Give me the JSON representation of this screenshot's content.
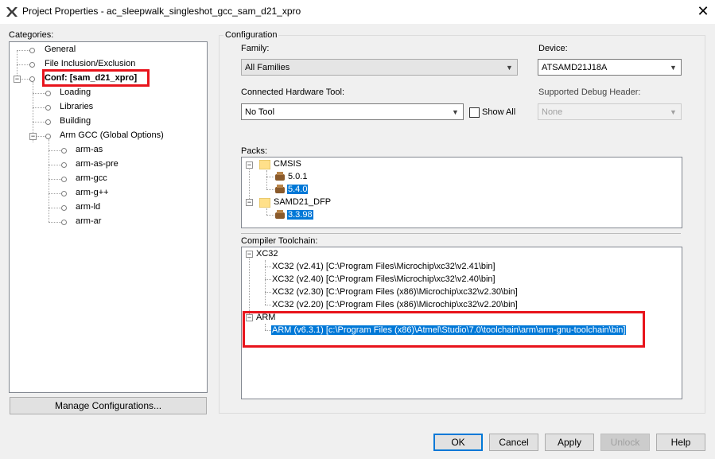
{
  "window": {
    "title": "Project Properties - ac_sleepwalk_singleshot_gcc_sam_d21_xpro"
  },
  "categories": {
    "label": "Categories:",
    "items": [
      {
        "label": "General"
      },
      {
        "label": "File Inclusion/Exclusion"
      },
      {
        "label": "Conf: [sam_d21_xpro]"
      },
      {
        "label": "Loading"
      },
      {
        "label": "Libraries"
      },
      {
        "label": "Building"
      },
      {
        "label": "Arm GCC (Global Options)"
      },
      {
        "label": "arm-as"
      },
      {
        "label": "arm-as-pre"
      },
      {
        "label": "arm-gcc"
      },
      {
        "label": "arm-g++"
      },
      {
        "label": "arm-ld"
      },
      {
        "label": "arm-ar"
      }
    ],
    "manage_button": "Manage Configurations..."
  },
  "configuration": {
    "group_title": "Configuration",
    "family_label": "Family:",
    "family_value": "All Families",
    "device_label": "Device:",
    "device_value": "ATSAMD21J18A",
    "hardware_label": "Connected Hardware Tool:",
    "hardware_value": "No Tool",
    "show_all_label": "Show All",
    "debug_header_label": "Supported Debug Header:",
    "debug_header_value": "None",
    "packs_label": "Packs:",
    "packs": [
      {
        "name": "CMSIS",
        "versions": [
          "5.0.1",
          "5.4.0"
        ]
      },
      {
        "name": "SAMD21_DFP",
        "versions": [
          "3.3.98"
        ]
      }
    ],
    "toolchain_label": "Compiler Toolchain:",
    "toolchains": [
      {
        "name": "XC32",
        "entries": [
          "XC32 (v2.41) [C:\\Program Files\\Microchip\\xc32\\v2.41\\bin]",
          "XC32 (v2.40) [C:\\Program Files\\Microchip\\xc32\\v2.40\\bin]",
          "XC32 (v2.30) [C:\\Program Files (x86)\\Microchip\\xc32\\v2.30\\bin]",
          "XC32 (v2.20) [C:\\Program Files (x86)\\Microchip\\xc32\\v2.20\\bin]"
        ]
      },
      {
        "name": "ARM",
        "entries": [
          "ARM (v6.3.1) [c:\\Program Files (x86)\\Atmel\\Studio\\7.0\\toolchain\\arm\\arm-gnu-toolchain\\bin]"
        ]
      }
    ]
  },
  "buttons": {
    "ok": "OK",
    "cancel": "Cancel",
    "apply": "Apply",
    "unlock": "Unlock",
    "help": "Help"
  },
  "colors": {
    "selection": "#0078d7",
    "highlight_box": "#e8141c"
  }
}
